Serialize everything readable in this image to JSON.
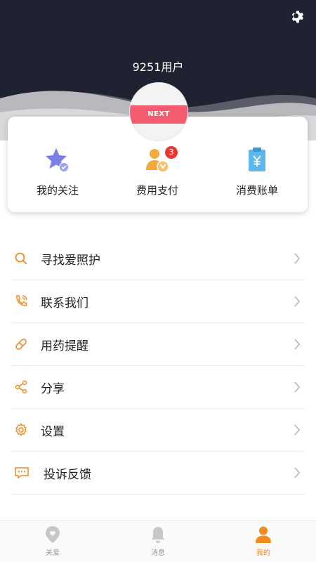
{
  "header": {
    "username": "9251用户",
    "avatar_text": "NEXT",
    "settings_icon": "gear-icon"
  },
  "quick_actions": [
    {
      "label": "我的关注",
      "icon": "star-check-icon"
    },
    {
      "label": "费用支付",
      "icon": "person-coin-icon",
      "badge": "3"
    },
    {
      "label": "消费账单",
      "icon": "bill-yuan-icon"
    }
  ],
  "menu": [
    {
      "label": "寻找爱照护",
      "icon": "search-icon"
    },
    {
      "label": "联系我们",
      "icon": "phone-icon"
    },
    {
      "label": "用药提醒",
      "icon": "pill-icon"
    },
    {
      "label": "分享",
      "icon": "share-icon"
    },
    {
      "label": "设置",
      "icon": "gear-icon"
    },
    {
      "label": "投诉反馈",
      "icon": "feedback-icon"
    }
  ],
  "tabbar": [
    {
      "label": "关爱",
      "icon": "location-heart-icon"
    },
    {
      "label": "消息",
      "icon": "bell-icon"
    },
    {
      "label": "我的",
      "icon": "user-icon",
      "active": true
    }
  ],
  "colors": {
    "header_bg": "#1f2230",
    "accent": "#f28b1e",
    "badge": "#e53935",
    "avatar_band": "#f55b6f"
  }
}
